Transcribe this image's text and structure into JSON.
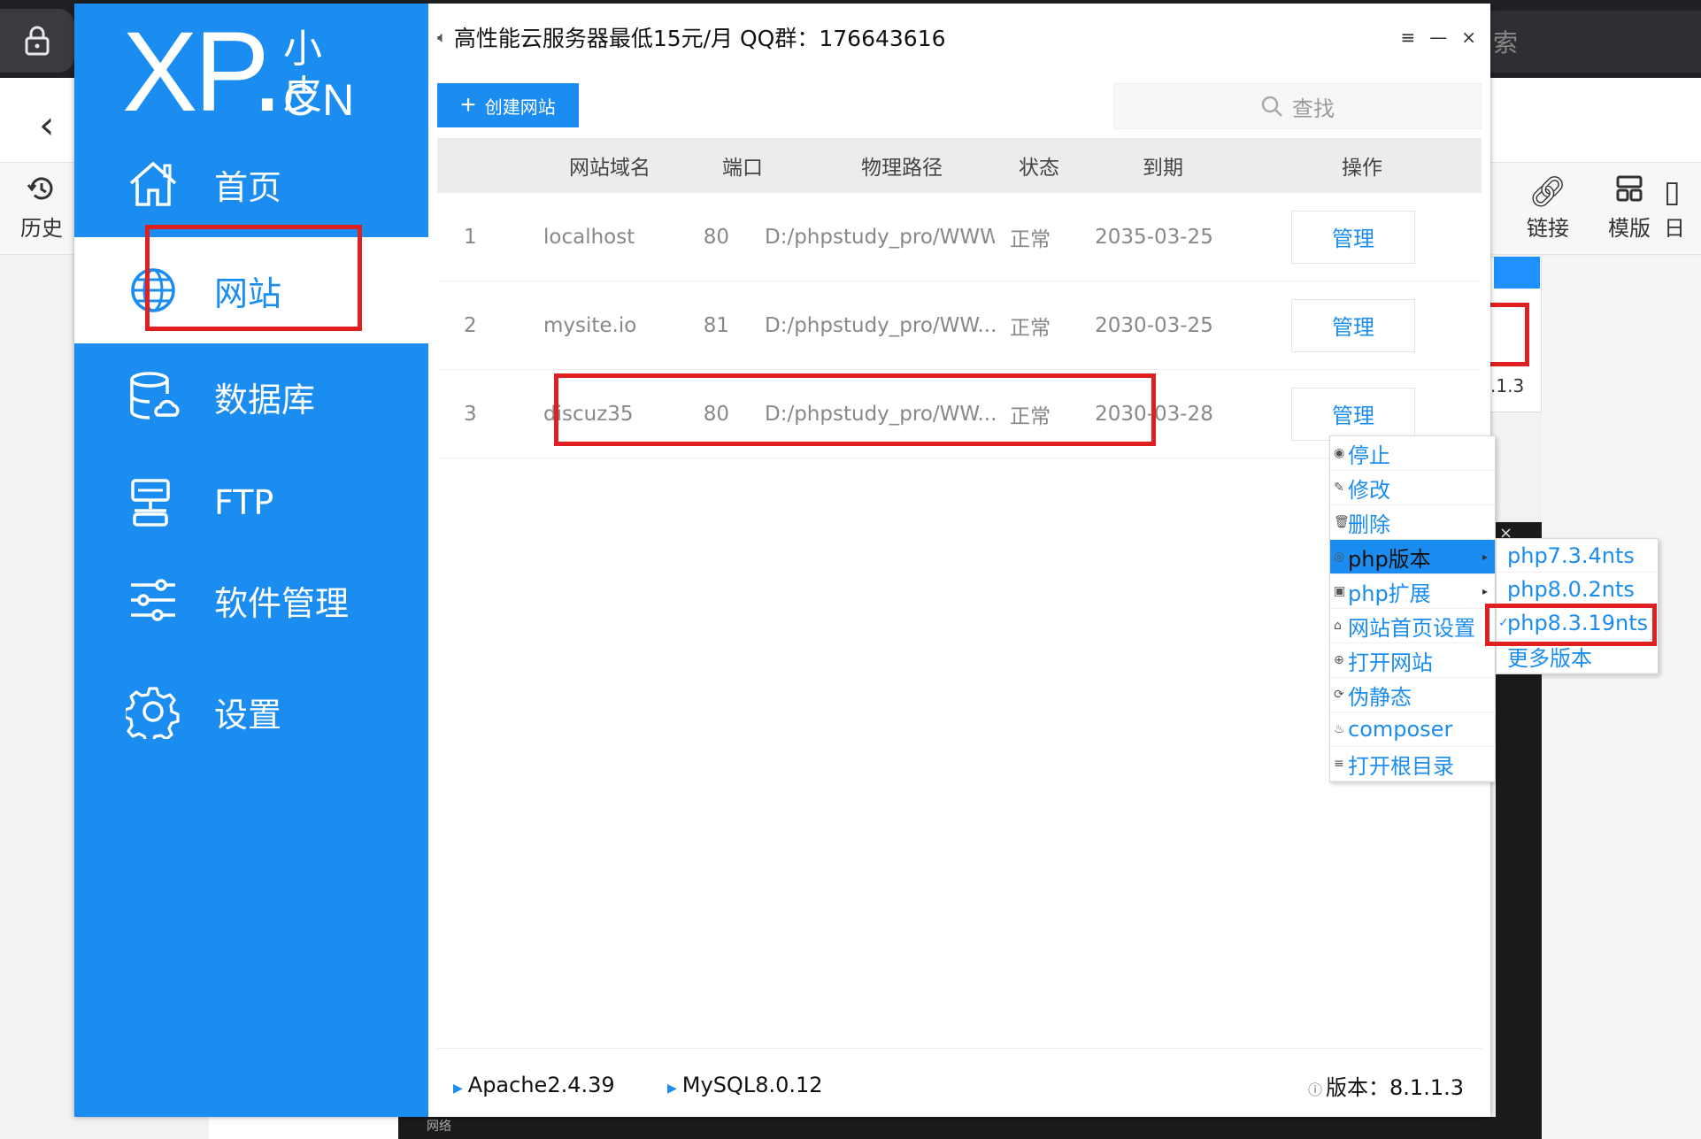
{
  "background": {
    "search_fragment": "索",
    "tools": [
      {
        "icon": "history-icon",
        "label": "历史"
      },
      {
        "icon": "link-icon",
        "label": "链接"
      },
      {
        "icon": "template-icon",
        "label": "模版"
      },
      {
        "icon": "more-icon",
        "label": "日"
      }
    ],
    "version_fragment": ".1.3",
    "bottom_tab": "网络"
  },
  "app": {
    "logo": {
      "xp": "XP",
      "small": "小皮",
      "cn": "CN"
    },
    "banner": "高性能云服务器最低15元/月  QQ群：176643616",
    "window_controls": {
      "menu": "≡",
      "minimize": "—",
      "close": "×"
    },
    "sidebar": [
      {
        "icon": "home-icon",
        "label": "首页"
      },
      {
        "icon": "globe-icon",
        "label": "网站",
        "active": true
      },
      {
        "icon": "database-icon",
        "label": "数据库"
      },
      {
        "icon": "ftp-icon",
        "label": "FTP"
      },
      {
        "icon": "sliders-icon",
        "label": "软件管理"
      },
      {
        "icon": "gear-icon",
        "label": "设置"
      }
    ],
    "create_button": "创建网站",
    "search_placeholder": "查找",
    "table": {
      "headers": [
        "网站域名",
        "端口",
        "物理路径",
        "状态",
        "到期",
        "操作"
      ],
      "rows": [
        {
          "no": "1",
          "domain": "localhost",
          "port": "80",
          "path": "D:/phpstudy_pro/WWW",
          "status": "正常",
          "expire": "2035-03-25",
          "action": "管理"
        },
        {
          "no": "2",
          "domain": "mysite.io",
          "port": "81",
          "path": "D:/phpstudy_pro/WW...",
          "status": "正常",
          "expire": "2030-03-25",
          "action": "管理"
        },
        {
          "no": "3",
          "domain": "discuz35",
          "port": "80",
          "path": "D:/phpstudy_pro/WW...",
          "status": "正常",
          "expire": "2030-03-28",
          "action": "管理"
        }
      ]
    },
    "context_menu": [
      {
        "icon": "stop-icon",
        "glyph": "◉",
        "label": "停止"
      },
      {
        "icon": "pencil-icon",
        "glyph": "✎",
        "label": "修改"
      },
      {
        "icon": "trash-icon",
        "glyph": "🗑",
        "label": "删除"
      },
      {
        "icon": "php-icon",
        "glyph": "◎",
        "label": "php版本",
        "highlighted": true,
        "submenu": true
      },
      {
        "icon": "extension-icon",
        "glyph": "▣",
        "label": "php扩展",
        "submenu": true
      },
      {
        "icon": "homepage-icon",
        "glyph": "⌂",
        "label": "网站首页设置"
      },
      {
        "icon": "open-site-icon",
        "glyph": "⊕",
        "label": "打开网站"
      },
      {
        "icon": "rewrite-icon",
        "glyph": "⟳",
        "label": "伪静态"
      },
      {
        "icon": "composer-icon",
        "glyph": "♨",
        "label": "composer"
      },
      {
        "icon": "folder-list-icon",
        "glyph": "≡",
        "label": "打开根目录"
      }
    ],
    "php_submenu": [
      {
        "label": "php7.3.4nts",
        "checked": false
      },
      {
        "label": "php8.0.2nts",
        "checked": false
      },
      {
        "label": "php8.3.19nts",
        "checked": true
      },
      {
        "label": "更多版本",
        "checked": false
      }
    ],
    "status_bar": {
      "apache": "Apache2.4.39",
      "mysql": "MySQL8.0.12",
      "version_label": "版本：8.1.1.3"
    },
    "colors": {
      "primary": "#1b8cf0",
      "highlight": "#e02020"
    }
  }
}
